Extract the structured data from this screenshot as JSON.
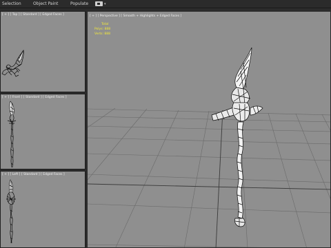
{
  "ribbon": {
    "tabs": [
      "Selection",
      "Object Paint",
      "Populate"
    ]
  },
  "viewports": {
    "top": {
      "label": "[ + ] [ Top ] [ Standard ] [ Edged Faces ]"
    },
    "front": {
      "label": "[ + ] [ Front ] [ Standard ] [ Edged Faces ]"
    },
    "left": {
      "label": "[ + ] [ Left ] [ Standard ] [ Edged Faces ]"
    },
    "perspective": {
      "label": "[ + ] [ Perspective ] [ Smooth + Highlights + Edged Faces ]",
      "stats": {
        "total_label": "Total",
        "polys_label": "Polys:",
        "polys_value": "888",
        "verts_label": "Verts:",
        "verts_value": "888"
      }
    }
  },
  "colors": {
    "viewport_bg": "#8f8f8f",
    "stats_text": "#f2e83a",
    "ui_dark": "#2b2b2b"
  }
}
